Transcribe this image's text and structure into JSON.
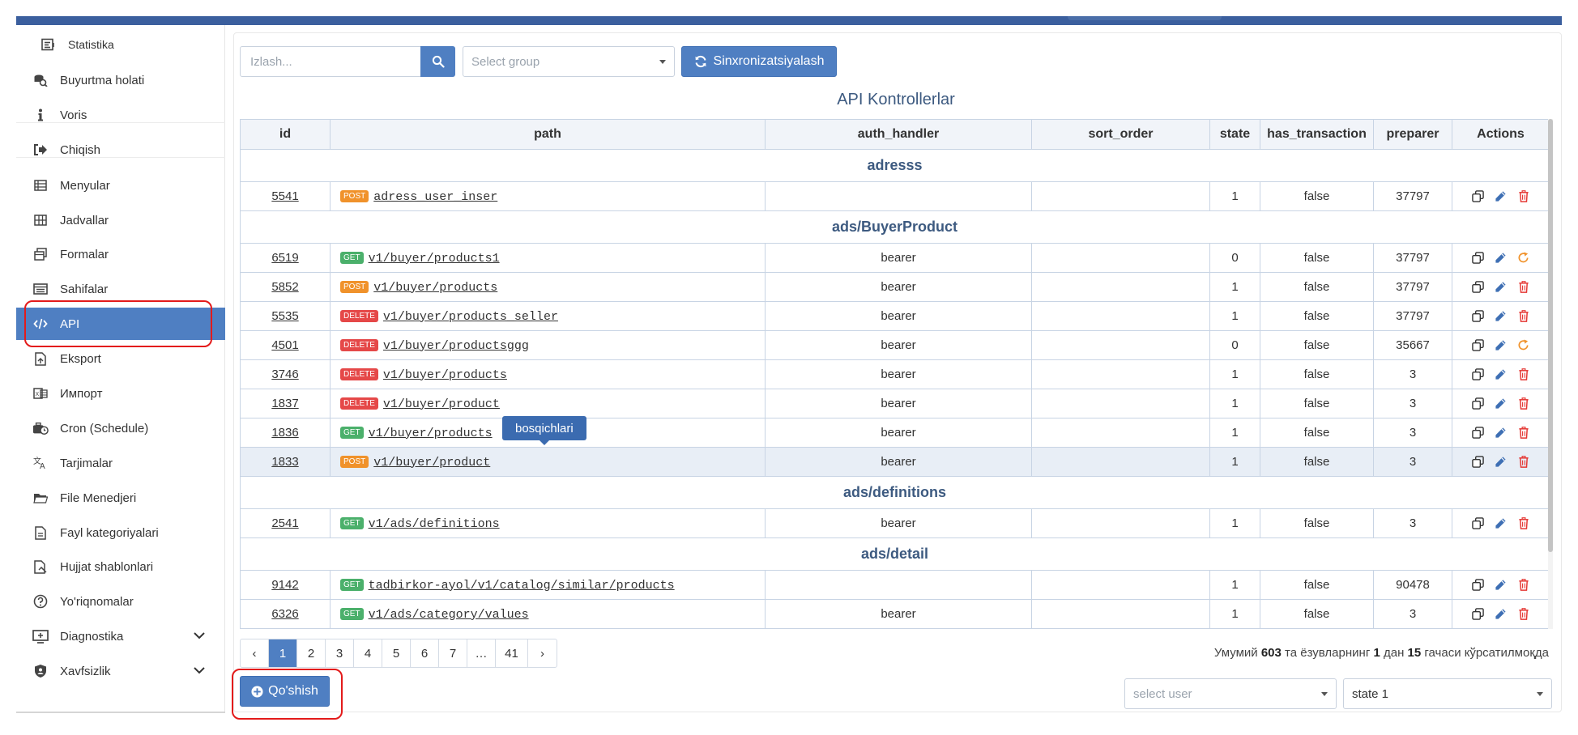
{
  "sidebar": {
    "items": [
      {
        "label": "Statistika",
        "icon": "chart-list-icon"
      },
      {
        "label": "Buyurtma holati",
        "icon": "order-search-icon"
      },
      {
        "label": "Voris",
        "icon": "info-icon"
      },
      {
        "label": "Chiqish",
        "icon": "logout-icon"
      },
      {
        "label": "Menyular",
        "icon": "menu-list-icon"
      },
      {
        "label": "Jadvallar",
        "icon": "table-grid-icon"
      },
      {
        "label": "Formalar",
        "icon": "forms-icon"
      },
      {
        "label": "Sahifalar",
        "icon": "pages-icon"
      },
      {
        "label": "API",
        "icon": "code-icon"
      },
      {
        "label": "Eksport",
        "icon": "export-file-icon"
      },
      {
        "label": "Импорт",
        "icon": "import-file-icon"
      },
      {
        "label": "Cron (Schedule)",
        "icon": "schedule-icon"
      },
      {
        "label": "Tarjimalar",
        "icon": "translate-icon"
      },
      {
        "label": "File Menedjeri",
        "icon": "folder-icon"
      },
      {
        "label": "Fayl kategoriyalari",
        "icon": "file-icon"
      },
      {
        "label": "Hujjat shablonlari",
        "icon": "document-template-icon"
      },
      {
        "label": "Yo'riqnomalar",
        "icon": "help-circle-icon"
      },
      {
        "label": "Diagnostika",
        "icon": "monitor-icon"
      },
      {
        "label": "Xavfsizlik",
        "icon": "shield-icon"
      }
    ]
  },
  "toolbar": {
    "search_placeholder": "Izlash...",
    "group_placeholder": "Select group",
    "sync_label": "Sinxronizatsiyalash"
  },
  "table": {
    "title": "API Kontrollerlar",
    "headers": [
      "id",
      "path",
      "auth_handler",
      "sort_order",
      "state",
      "has_transaction",
      "preparer",
      "Actions"
    ],
    "groups": [
      {
        "name": "adresss",
        "rows": [
          {
            "id": "5541",
            "method": "POST",
            "path": "adress_user_inser",
            "auth": "",
            "sort": "",
            "state": "1",
            "tx": "false",
            "preparer": "37797",
            "third_action": "delete"
          }
        ]
      },
      {
        "name": "ads/BuyerProduct",
        "rows": [
          {
            "id": "6519",
            "method": "GET",
            "path": "v1/buyer/products1",
            "auth": "bearer",
            "sort": "",
            "state": "0",
            "tx": "false",
            "preparer": "37797",
            "third_action": "restore"
          },
          {
            "id": "5852",
            "method": "POST",
            "path": "v1/buyer/products",
            "auth": "bearer",
            "sort": "",
            "state": "1",
            "tx": "false",
            "preparer": "37797",
            "third_action": "delete"
          },
          {
            "id": "5535",
            "method": "DELETE",
            "path": "v1/buyer/products_seller",
            "auth": "bearer",
            "sort": "",
            "state": "1",
            "tx": "false",
            "preparer": "37797",
            "third_action": "delete"
          },
          {
            "id": "4501",
            "method": "DELETE",
            "path": "v1/buyer/productsggg",
            "auth": "bearer",
            "sort": "",
            "state": "0",
            "tx": "false",
            "preparer": "35667",
            "third_action": "restore"
          },
          {
            "id": "3746",
            "method": "DELETE",
            "path": "v1/buyer/products",
            "auth": "bearer",
            "sort": "",
            "state": "1",
            "tx": "false",
            "preparer": "3",
            "third_action": "delete"
          },
          {
            "id": "1837",
            "method": "DELETE",
            "path": "v1/buyer/product",
            "auth": "bearer",
            "sort": "",
            "state": "1",
            "tx": "false",
            "preparer": "3",
            "third_action": "delete"
          },
          {
            "id": "1836",
            "method": "GET",
            "path": "v1/buyer/products",
            "auth": "bearer",
            "sort": "",
            "state": "1",
            "tx": "false",
            "preparer": "3",
            "third_action": "delete"
          },
          {
            "id": "1833",
            "method": "POST",
            "path": "v1/buyer/product",
            "auth": "bearer",
            "sort": "",
            "state": "1",
            "tx": "false",
            "preparer": "3",
            "third_action": "delete",
            "selected": true
          }
        ]
      },
      {
        "name": "ads/definitions",
        "rows": [
          {
            "id": "2541",
            "method": "GET",
            "path": "v1/ads/definitions",
            "auth": "bearer",
            "sort": "",
            "state": "1",
            "tx": "false",
            "preparer": "3",
            "third_action": "delete"
          }
        ]
      },
      {
        "name": "ads/detail",
        "rows": [
          {
            "id": "9142",
            "method": "GET",
            "path": "tadbirkor-ayol/v1/catalog/similar/products",
            "auth": "",
            "sort": "",
            "state": "1",
            "tx": "false",
            "preparer": "90478",
            "third_action": "delete"
          },
          {
            "id": "6326",
            "method": "GET",
            "path": "v1/ads/category/values",
            "auth": "bearer",
            "sort": "",
            "state": "1",
            "tx": "false",
            "preparer": "3",
            "third_action": "delete"
          }
        ]
      }
    ]
  },
  "tooltip": {
    "text": "bosqichlari"
  },
  "pagination": {
    "prev": "‹",
    "pages": [
      "1",
      "2",
      "3",
      "4",
      "5",
      "6",
      "7",
      "…",
      "41"
    ],
    "current": "1",
    "next": "›"
  },
  "summary": {
    "prefix": "Умумий",
    "total": "603",
    "mid1": "та ёзувларнинг",
    "from": "1",
    "mid2": "дан",
    "to": "15",
    "suffix": "гачаси кўрсатилмоқда"
  },
  "footer": {
    "add_label": "Qo'shish",
    "user_placeholder": "select user",
    "state_value": "state 1"
  },
  "colors": {
    "primary": "#4f7fc2",
    "highlight": "#e31b1b",
    "post": "#f0922b",
    "get": "#4bb06b",
    "delete": "#e54848"
  }
}
